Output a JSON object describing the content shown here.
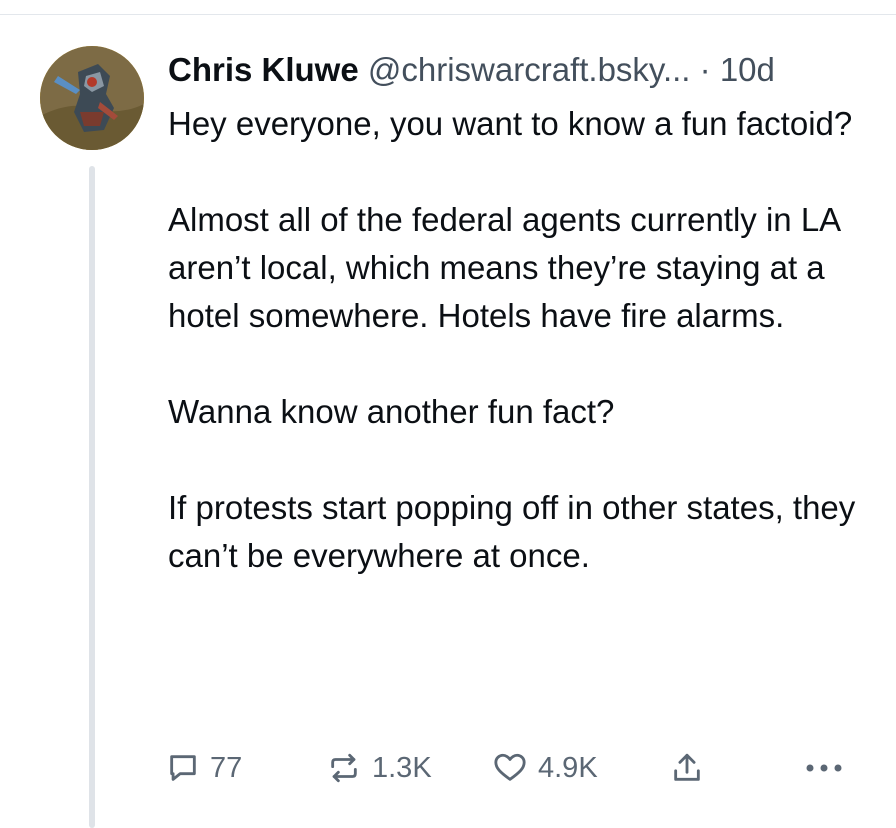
{
  "post": {
    "author": {
      "display_name": "Chris Kluwe",
      "handle": "@chriswarcraft.bsky...",
      "separator": "·",
      "time": "10d"
    },
    "text": "Hey everyone, you want to know a fun factoid?\n\nAlmost all of the federal agents currently in LA aren’t local, which means they’re staying at a hotel somewhere. Hotels have fire alarms.\n\nWanna know another fun fact?\n\nIf protests start popping off in other states, they can’t be everywhere at once.",
    "actions": {
      "reply": {
        "icon": "reply-icon",
        "count": "77"
      },
      "repost": {
        "icon": "repost-icon",
        "count": "1.3K"
      },
      "like": {
        "icon": "heart-icon",
        "count": "4.9K"
      },
      "share": {
        "icon": "share-icon"
      },
      "more": {
        "icon": "more-icon"
      }
    }
  },
  "colors": {
    "text": "#0b0f14",
    "secondary_text": "#434f5c",
    "action_gray": "#5b6774",
    "thread_line": "#dfe3e8"
  }
}
